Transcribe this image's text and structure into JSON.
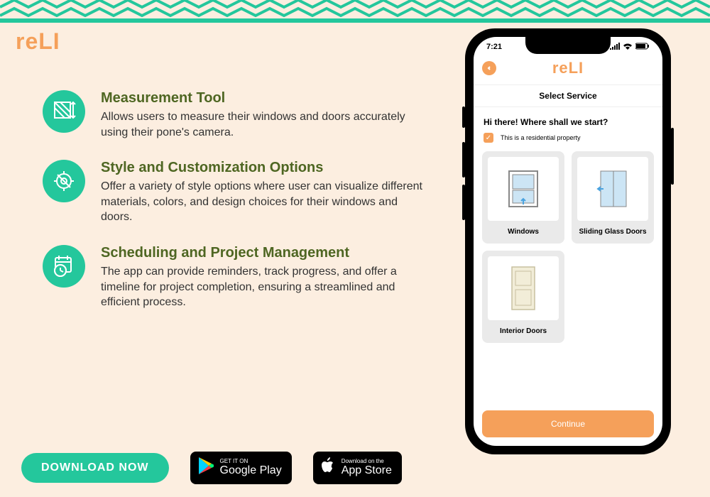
{
  "brand": "reLI",
  "features": [
    {
      "title": "Measurement Tool",
      "desc": "Allows users to measure their windows and doors accurately using their pone's camera."
    },
    {
      "title": "Style and Customization Options",
      "desc": "Offer a variety of style options where user can visualize different materials, colors, and design choices for their windows and doors."
    },
    {
      "title": "Scheduling and Project Management",
      "desc": "The app can provide reminders, track progress, and offer a timeline for project completion, ensuring a streamlined and efficient process."
    }
  ],
  "phone": {
    "time": "7:21",
    "app_logo": "reLI",
    "screen_title": "Select Service",
    "prompt": "Hi there! Where shall we start?",
    "checkbox_label": "This is a residential property",
    "services": [
      {
        "label": "Windows"
      },
      {
        "label": "Sliding Glass Doors"
      },
      {
        "label": "Interior Doors"
      }
    ],
    "continue": "Continue"
  },
  "cta": {
    "download": "DOWNLOAD NOW",
    "google_small": "GET IT ON",
    "google_big": "Google Play",
    "apple_small": "Download on the",
    "apple_big": "App Store"
  }
}
